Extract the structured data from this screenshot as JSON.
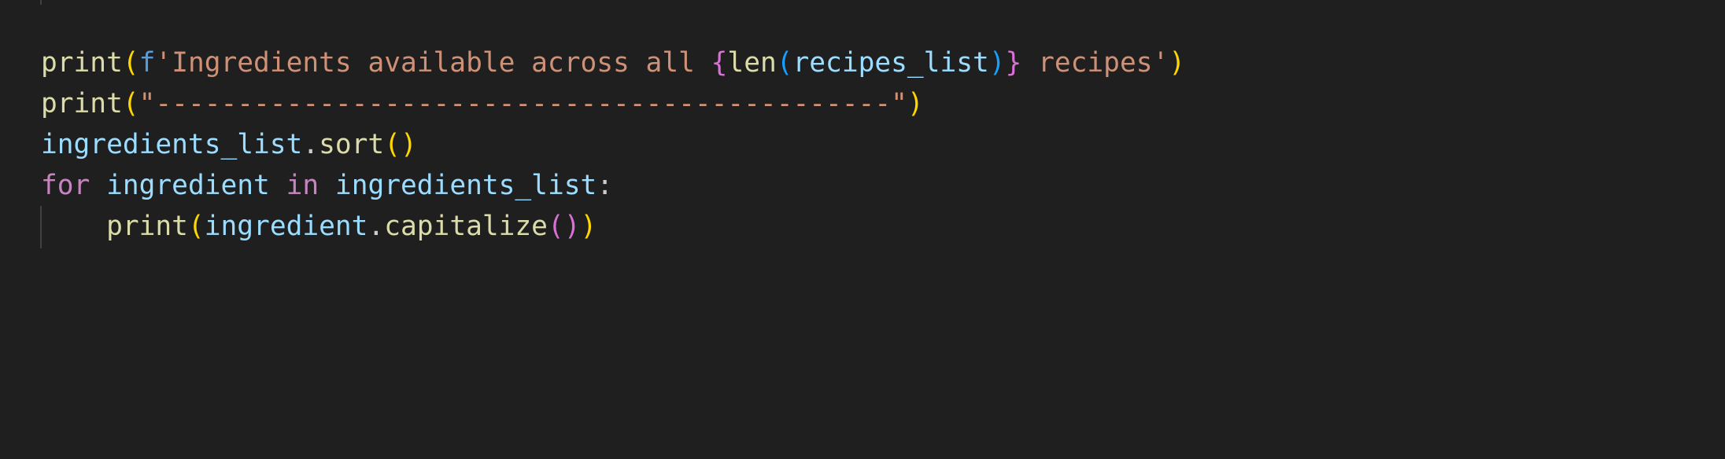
{
  "editor": {
    "theme_colors": {
      "background": "#1f1f1f",
      "function": "#dcdcaa",
      "bracket1": "#ffd700",
      "bracket2": "#da70d6",
      "bracket3": "#179fff",
      "string": "#ce9178",
      "keyword": "#569cd6",
      "variable": "#9cdcfe",
      "control": "#c586c0",
      "text": "#cccccc"
    },
    "lines": [
      [
        {
          "t": "print",
          "c": "fn"
        },
        {
          "t": "(",
          "c": "p1"
        },
        {
          "t": "f",
          "c": "kw"
        },
        {
          "t": "'Ingredients available across all ",
          "c": "str"
        },
        {
          "t": "{",
          "c": "p2"
        },
        {
          "t": "len",
          "c": "fn"
        },
        {
          "t": "(",
          "c": "p3"
        },
        {
          "t": "recipes_list",
          "c": "var"
        },
        {
          "t": ")",
          "c": "p3"
        },
        {
          "t": "}",
          "c": "p2"
        },
        {
          "t": " recipes'",
          "c": "str"
        },
        {
          "t": ")",
          "c": "p1"
        }
      ],
      [
        {
          "t": "print",
          "c": "fn"
        },
        {
          "t": "(",
          "c": "p1"
        },
        {
          "t": "\"---------------------------------------------\"",
          "c": "str"
        },
        {
          "t": ")",
          "c": "p1"
        }
      ],
      [
        {
          "t": "ingredients_list",
          "c": "var"
        },
        {
          "t": ".",
          "c": "txt"
        },
        {
          "t": "sort",
          "c": "fn"
        },
        {
          "t": "()",
          "c": "p1"
        }
      ],
      [
        {
          "t": "for",
          "c": "ctl"
        },
        {
          "t": " ",
          "c": "txt"
        },
        {
          "t": "ingredient",
          "c": "var"
        },
        {
          "t": " ",
          "c": "txt"
        },
        {
          "t": "in",
          "c": "ctl"
        },
        {
          "t": " ",
          "c": "txt"
        },
        {
          "t": "ingredients_list",
          "c": "var"
        },
        {
          "t": ":",
          "c": "txt"
        }
      ],
      [
        {
          "t": "    ",
          "c": "txt"
        },
        {
          "t": "print",
          "c": "fn"
        },
        {
          "t": "(",
          "c": "p1"
        },
        {
          "t": "ingredient",
          "c": "var"
        },
        {
          "t": ".",
          "c": "txt"
        },
        {
          "t": "capitalize",
          "c": "fn"
        },
        {
          "t": "(",
          "c": "p2"
        },
        {
          "t": ")",
          "c": "p2"
        },
        {
          "t": ")",
          "c": "p1"
        }
      ]
    ]
  }
}
